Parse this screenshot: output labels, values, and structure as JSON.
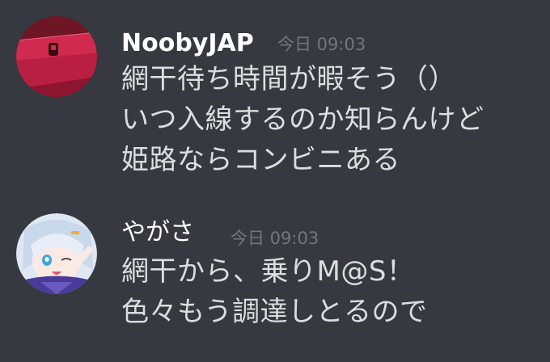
{
  "messages": [
    {
      "username": "NoobyJAP",
      "timestamp": "今日 09:03",
      "avatar_icon": "pink-box-avatar",
      "lines": [
        "網干待ち時間が暇そう（）",
        "いつ入線するのか知らんけど",
        "姫路ならコンビニある"
      ]
    },
    {
      "username": "やがさ",
      "timestamp": "今日 09:03",
      "avatar_icon": "anime-girl-avatar",
      "lines": [
        "網干から、乗りM@S！",
        "色々もう調達しとるので"
      ]
    }
  ],
  "colors": {
    "background": "#36393f",
    "username": "#ffffff",
    "timestamp": "#72767d",
    "message_text": "#dcddde"
  }
}
